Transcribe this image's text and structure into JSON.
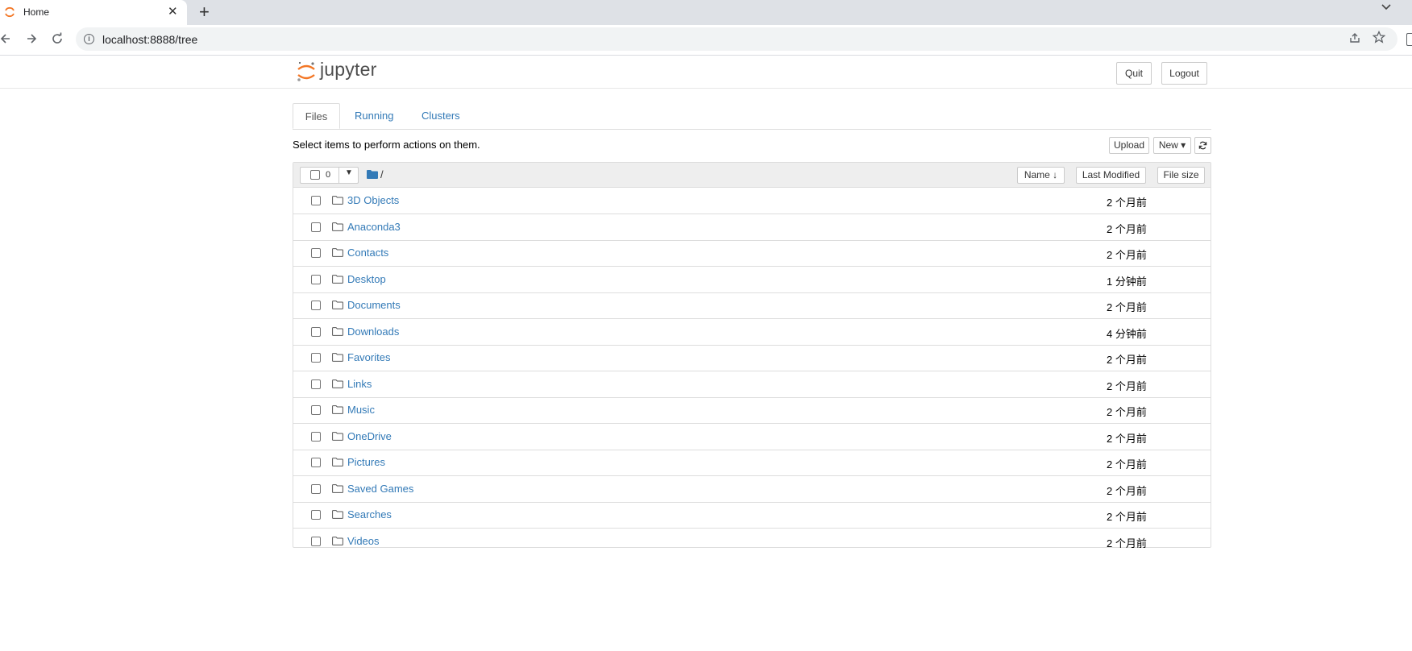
{
  "browser": {
    "tab_title": "Home",
    "tab_close": "✕",
    "new_tab": "+",
    "url": "localhost:8888/tree"
  },
  "header": {
    "logo_text": "jupyter",
    "quit_label": "Quit",
    "logout_label": "Logout"
  },
  "tabs": [
    {
      "label": "Files",
      "active": true
    },
    {
      "label": "Running",
      "active": false
    },
    {
      "label": "Clusters",
      "active": false
    }
  ],
  "toolbar": {
    "info": "Select items to perform actions on them.",
    "upload_label": "Upload",
    "new_label": "New ▾",
    "refresh_icon": "refresh-icon"
  },
  "list_header": {
    "selected_count": "0",
    "path": "/",
    "name_label": "Name ↓",
    "last_modified_label": "Last Modified",
    "file_size_label": "File size"
  },
  "files": [
    {
      "name": "3D Objects",
      "modified": "2 个月前"
    },
    {
      "name": "Anaconda3",
      "modified": "2 个月前"
    },
    {
      "name": "Contacts",
      "modified": "2 个月前"
    },
    {
      "name": "Desktop",
      "modified": "1 分钟前"
    },
    {
      "name": "Documents",
      "modified": "2 个月前"
    },
    {
      "name": "Downloads",
      "modified": "4 分钟前"
    },
    {
      "name": "Favorites",
      "modified": "2 个月前"
    },
    {
      "name": "Links",
      "modified": "2 个月前"
    },
    {
      "name": "Music",
      "modified": "2 个月前"
    },
    {
      "name": "OneDrive",
      "modified": "2 个月前"
    },
    {
      "name": "Pictures",
      "modified": "2 个月前"
    },
    {
      "name": "Saved Games",
      "modified": "2 个月前"
    },
    {
      "name": "Searches",
      "modified": "2 个月前"
    },
    {
      "name": "Videos",
      "modified": "2 个月前"
    }
  ],
  "colors": {
    "link": "#337ab7",
    "jupyter_orange": "#f37726",
    "folder_blue": "#337ab7"
  }
}
